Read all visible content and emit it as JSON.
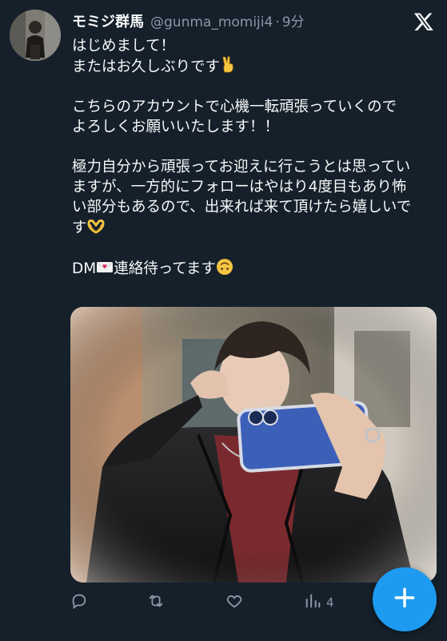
{
  "tweet": {
    "author": {
      "display_name": "モミジ群馬",
      "handle": "@gunma_momiji4",
      "separator": "·",
      "time": "9分"
    },
    "lines": {
      "l1": "はじめまして！",
      "l2": "またはお久しぶりです",
      "l3": "こちらのアカウントで心機一転頑張っていくので",
      "l4": "よろしくお願いいたします！！",
      "l5": "極力自分から頑張ってお迎えに行こうとは思ってい",
      "l6": "ますが、一方的にフォローはやはり4度目もあり怖",
      "l7": "い部分もあるので、出来れば来て頂けたら嬉しいで",
      "l8": "す",
      "l9_prefix": "DM",
      "l9_suffix": "連絡待ってます"
    },
    "emoji": {
      "victory": "victory-hand-emoji",
      "heart_hands": "heart-hands-emoji",
      "envelope": "love-letter-emoji",
      "upside_down": "upside-down-face-emoji"
    },
    "media": {
      "description_icon": "photo"
    },
    "actions": {
      "reply_icon": "reply-icon",
      "retweet_icon": "retweet-icon",
      "like_icon": "like-icon",
      "views_icon": "views-icon",
      "views_count": "4"
    },
    "fab_icon": "compose-plus-icon"
  },
  "colors": {
    "background": "#15202b",
    "text_primary": "#f7f9f9",
    "text_secondary": "#8b98a5",
    "accent": "#1d9bf0"
  }
}
